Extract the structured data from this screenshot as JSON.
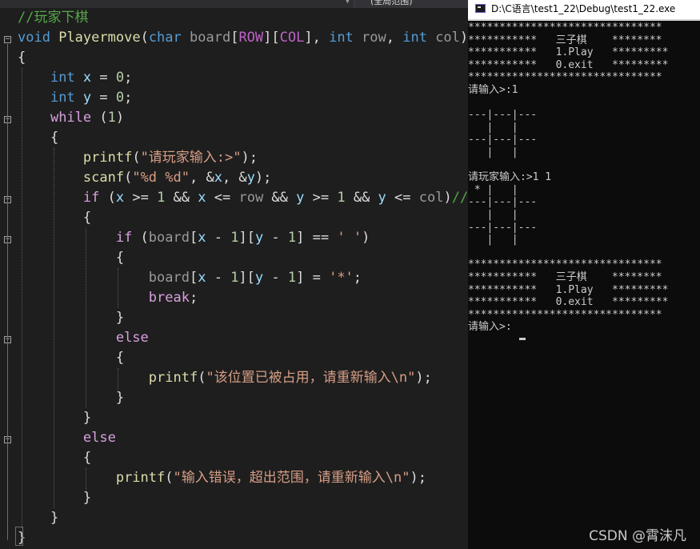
{
  "editor": {
    "scope_label": "(全局范围)",
    "code_lines": [
      {
        "tokens": [
          {
            "t": "//玩家下棋",
            "c": "cmt"
          }
        ]
      },
      {
        "tokens": [
          {
            "t": "void",
            "c": "kw"
          },
          {
            "t": " "
          },
          {
            "t": "Playermove",
            "c": "fn"
          },
          {
            "t": "("
          },
          {
            "t": "char",
            "c": "kw"
          },
          {
            "t": " board",
            "c": "param"
          },
          {
            "t": "["
          },
          {
            "t": "ROW",
            "c": "macro"
          },
          {
            "t": "]["
          },
          {
            "t": "COL",
            "c": "macro"
          },
          {
            "t": "], "
          },
          {
            "t": "int",
            "c": "kw"
          },
          {
            "t": " row",
            "c": "param"
          },
          {
            "t": ", "
          },
          {
            "t": "int",
            "c": "kw"
          },
          {
            "t": " col",
            "c": "param"
          },
          {
            "t": ")"
          }
        ]
      },
      {
        "tokens": [
          {
            "t": "{"
          }
        ]
      },
      {
        "tokens": [
          {
            "t": "    "
          },
          {
            "t": "int",
            "c": "kw"
          },
          {
            "t": " "
          },
          {
            "t": "x",
            "c": "var"
          },
          {
            "t": " = "
          },
          {
            "t": "0",
            "c": "num"
          },
          {
            "t": ";"
          }
        ]
      },
      {
        "tokens": [
          {
            "t": "    "
          },
          {
            "t": "int",
            "c": "kw"
          },
          {
            "t": " "
          },
          {
            "t": "y",
            "c": "var"
          },
          {
            "t": " = "
          },
          {
            "t": "0",
            "c": "num"
          },
          {
            "t": ";"
          }
        ]
      },
      {
        "tokens": [
          {
            "t": "    "
          },
          {
            "t": "while",
            "c": "ctl"
          },
          {
            "t": " ("
          },
          {
            "t": "1",
            "c": "num"
          },
          {
            "t": ")"
          }
        ]
      },
      {
        "tokens": [
          {
            "t": "    {"
          }
        ]
      },
      {
        "tokens": [
          {
            "t": "        "
          },
          {
            "t": "printf",
            "c": "fn"
          },
          {
            "t": "("
          },
          {
            "t": "\"请玩家输入:>\"",
            "c": "str"
          },
          {
            "t": ");"
          }
        ]
      },
      {
        "tokens": [
          {
            "t": "        "
          },
          {
            "t": "scanf",
            "c": "fn"
          },
          {
            "t": "("
          },
          {
            "t": "\"%d %d\"",
            "c": "str"
          },
          {
            "t": ", &"
          },
          {
            "t": "x",
            "c": "var"
          },
          {
            "t": ", &"
          },
          {
            "t": "y",
            "c": "var"
          },
          {
            "t": ");"
          }
        ]
      },
      {
        "tokens": [
          {
            "t": "        "
          },
          {
            "t": "if",
            "c": "ctl"
          },
          {
            "t": " ("
          },
          {
            "t": "x",
            "c": "var"
          },
          {
            "t": " >= "
          },
          {
            "t": "1",
            "c": "num"
          },
          {
            "t": " && "
          },
          {
            "t": "x",
            "c": "var"
          },
          {
            "t": " <= "
          },
          {
            "t": "row",
            "c": "param"
          },
          {
            "t": " && "
          },
          {
            "t": "y",
            "c": "var"
          },
          {
            "t": " >= "
          },
          {
            "t": "1",
            "c": "num"
          },
          {
            "t": " && "
          },
          {
            "t": "y",
            "c": "var"
          },
          {
            "t": " <= "
          },
          {
            "t": "col",
            "c": "param"
          },
          {
            "t": ")"
          },
          {
            "t": "//x",
            "c": "cmt"
          }
        ]
      },
      {
        "tokens": [
          {
            "t": "        {"
          }
        ]
      },
      {
        "tokens": [
          {
            "t": "            "
          },
          {
            "t": "if",
            "c": "ctl"
          },
          {
            "t": " ("
          },
          {
            "t": "board",
            "c": "param"
          },
          {
            "t": "["
          },
          {
            "t": "x",
            "c": "var"
          },
          {
            "t": " - "
          },
          {
            "t": "1",
            "c": "num"
          },
          {
            "t": "]["
          },
          {
            "t": "y",
            "c": "var"
          },
          {
            "t": " - "
          },
          {
            "t": "1",
            "c": "num"
          },
          {
            "t": "] == "
          },
          {
            "t": "' '",
            "c": "str"
          },
          {
            "t": ")"
          }
        ]
      },
      {
        "tokens": [
          {
            "t": "            {"
          }
        ]
      },
      {
        "tokens": [
          {
            "t": "                "
          },
          {
            "t": "board",
            "c": "param"
          },
          {
            "t": "["
          },
          {
            "t": "x",
            "c": "var"
          },
          {
            "t": " - "
          },
          {
            "t": "1",
            "c": "num"
          },
          {
            "t": "]["
          },
          {
            "t": "y",
            "c": "var"
          },
          {
            "t": " - "
          },
          {
            "t": "1",
            "c": "num"
          },
          {
            "t": "] = "
          },
          {
            "t": "'*'",
            "c": "str"
          },
          {
            "t": ";"
          }
        ]
      },
      {
        "tokens": [
          {
            "t": "                "
          },
          {
            "t": "break",
            "c": "ctl"
          },
          {
            "t": ";"
          }
        ]
      },
      {
        "tokens": [
          {
            "t": "            }"
          }
        ]
      },
      {
        "tokens": [
          {
            "t": "            "
          },
          {
            "t": "else",
            "c": "ctl"
          }
        ]
      },
      {
        "tokens": [
          {
            "t": "            {"
          }
        ]
      },
      {
        "tokens": [
          {
            "t": "                "
          },
          {
            "t": "printf",
            "c": "fn"
          },
          {
            "t": "("
          },
          {
            "t": "\"该位置已被占用，请重新输入\\n\"",
            "c": "str"
          },
          {
            "t": ");"
          }
        ]
      },
      {
        "tokens": [
          {
            "t": "            }"
          }
        ]
      },
      {
        "tokens": [
          {
            "t": "        }"
          }
        ]
      },
      {
        "tokens": [
          {
            "t": "        "
          },
          {
            "t": "else",
            "c": "ctl"
          }
        ]
      },
      {
        "tokens": [
          {
            "t": "        {"
          }
        ]
      },
      {
        "tokens": [
          {
            "t": "            "
          },
          {
            "t": "printf",
            "c": "fn"
          },
          {
            "t": "("
          },
          {
            "t": "\"输入错误，超出范围，请重新输入\\n\"",
            "c": "str"
          },
          {
            "t": ");"
          }
        ]
      },
      {
        "tokens": [
          {
            "t": "        }"
          }
        ]
      },
      {
        "tokens": [
          {
            "t": "    }"
          }
        ]
      },
      {
        "tokens": [
          {
            "t": "}"
          }
        ]
      }
    ]
  },
  "console": {
    "title": "D:\\C语言\\test1_22\\Debug\\test1_22.exe",
    "lines": [
      "*******************************",
      "***********   三子棋    ********",
      "***********   1.Play   *********",
      "***********   0.exit   *********",
      "*******************************",
      "请输入>:1",
      "",
      "---|---|---",
      "   |   |   ",
      "---|---|---",
      "   |   |   ",
      "",
      "请玩家输入:>1 1",
      " * |   |   ",
      "---|---|---",
      "   |   |   ",
      "---|---|---",
      "   |   |   ",
      "",
      "*******************************",
      "***********   三子棋    ********",
      "***********   1.Play   *********",
      "***********   0.exit   *********",
      "*******************************",
      "请输入>:"
    ]
  },
  "watermark": "CSDN @霄沫凡"
}
